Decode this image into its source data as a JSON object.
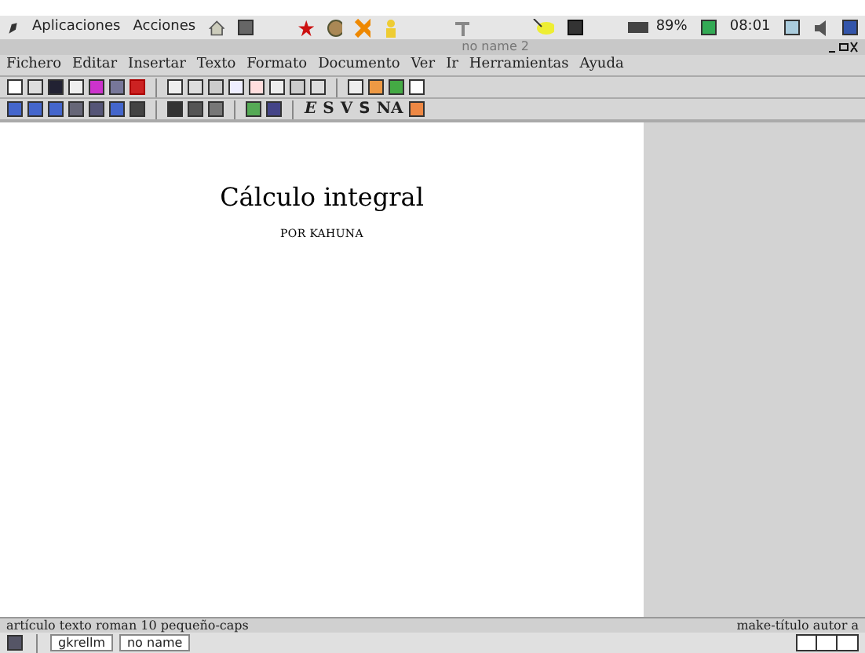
{
  "top_panel": {
    "menus": [
      "Aplicaciones",
      "Acciones"
    ],
    "battery": "89%",
    "clock": "08:01"
  },
  "window": {
    "title": "no name 2"
  },
  "menu_bar": [
    "Fichero",
    "Editar",
    "Insertar",
    "Texto",
    "Formato",
    "Documento",
    "Ver",
    "Ir",
    "Herramientas",
    "Ayuda"
  ],
  "text_style_buttons": [
    {
      "label": "E",
      "kind": "italic"
    },
    {
      "label": "S",
      "kind": "bold"
    },
    {
      "label": "V",
      "kind": "bold"
    },
    {
      "label": "S",
      "kind": "sans"
    },
    {
      "label": "NA",
      "kind": "smallcaps"
    }
  ],
  "document": {
    "title": "Cálculo integral",
    "author": "POR KAHUNA"
  },
  "status_bar": {
    "left": "artículo texto roman 10 pequeño-caps",
    "right": "make-título autor a"
  },
  "taskbar": [
    {
      "label": "gkrellm"
    },
    {
      "label": "no name"
    }
  ]
}
